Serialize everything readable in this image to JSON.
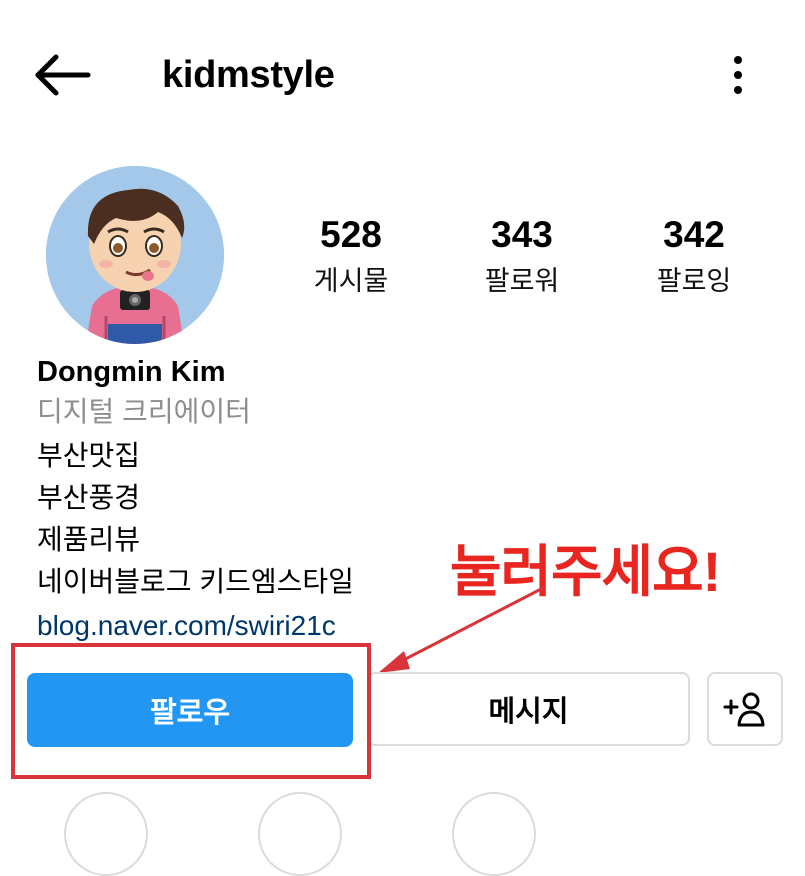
{
  "header": {
    "username": "kidmstyle",
    "back_icon": "arrow-left-icon",
    "more_icon": "more-vertical-icon"
  },
  "profile": {
    "avatar_icon": "cartoon-avatar",
    "stats": {
      "posts": {
        "count": "528",
        "label": "게시물"
      },
      "followers": {
        "count": "343",
        "label": "팔로워"
      },
      "following": {
        "count": "342",
        "label": "팔로잉"
      }
    },
    "display_name": "Dongmin Kim",
    "category": "디지털 크리에이터",
    "bio_lines": [
      "부산맛집",
      "부산풍경",
      "제품리뷰",
      "네이버블로그 키드엠스타일"
    ],
    "link": "blog.naver.com/swiri21c"
  },
  "actions": {
    "follow_label": "팔로우",
    "message_label": "메시지",
    "add_user_icon": "add-user-icon"
  },
  "annotation": {
    "callout_text": "눌러주세요!",
    "color": "#e8251f"
  },
  "colors": {
    "follow_button": "#2196f3",
    "link": "#00376b",
    "category": "#8e8e8e",
    "highlight_box": "#d9343a"
  }
}
